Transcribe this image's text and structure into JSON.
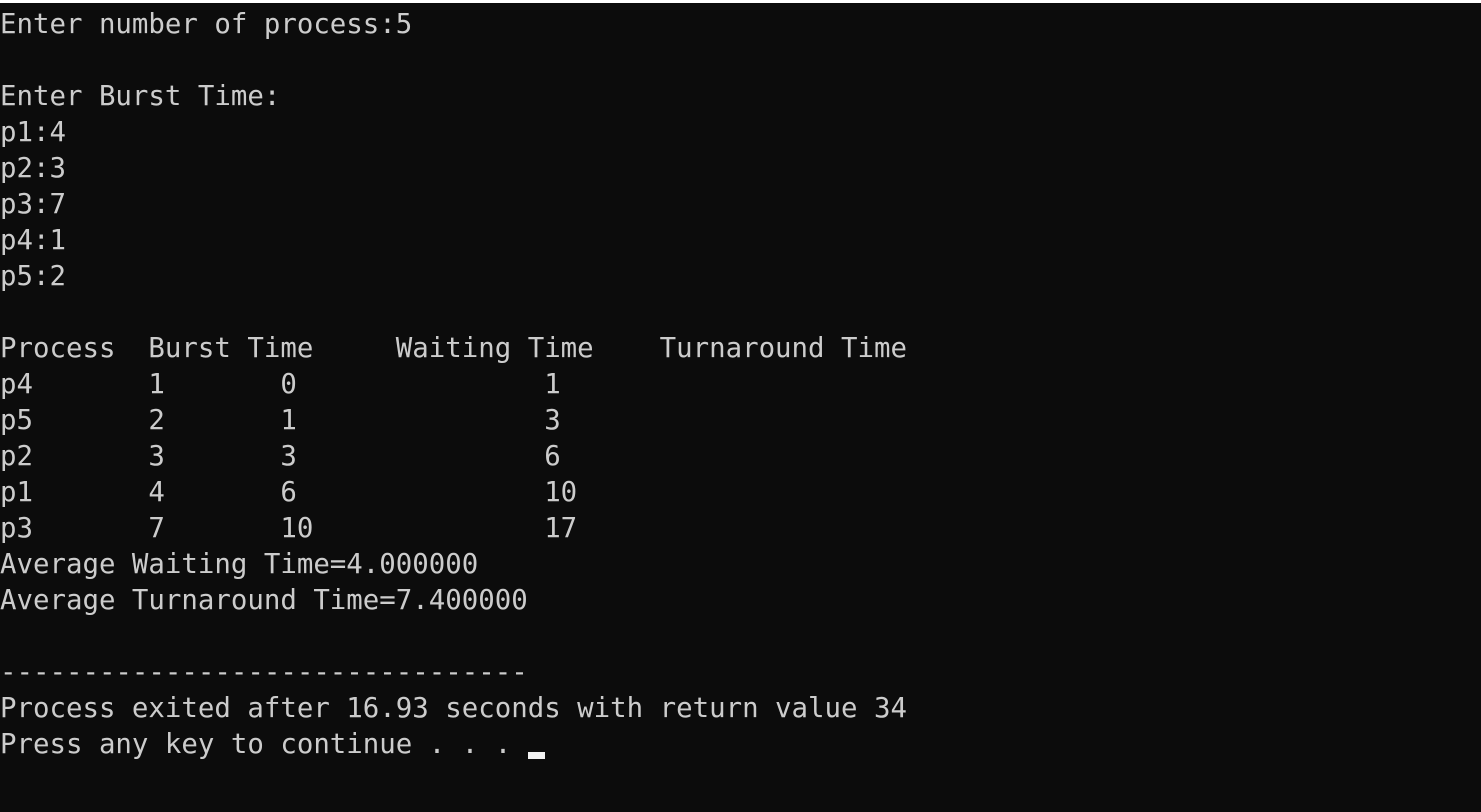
{
  "console": {
    "lines": [
      "Enter number of process:5",
      "",
      "Enter Burst Time:",
      "p1:4",
      "p2:3",
      "p3:7",
      "p4:1",
      "p5:2",
      "",
      "Process  Burst Time     Waiting Time    Turnaround Time",
      "p4       1       0               1",
      "p5       2       1               3",
      "p2       3       3               6",
      "p1       4       6               10",
      "p3       7       10              17",
      "Average Waiting Time=4.000000",
      "Average Turnaround Time=7.400000",
      "",
      "--------------------------------",
      "Process exited after 16.93 seconds with return value 34",
      "Press any key to continue . . . "
    ],
    "colors": {
      "background": "#0c0c0c",
      "text": "#cccccc",
      "cursor": "#f2f2f2"
    }
  }
}
